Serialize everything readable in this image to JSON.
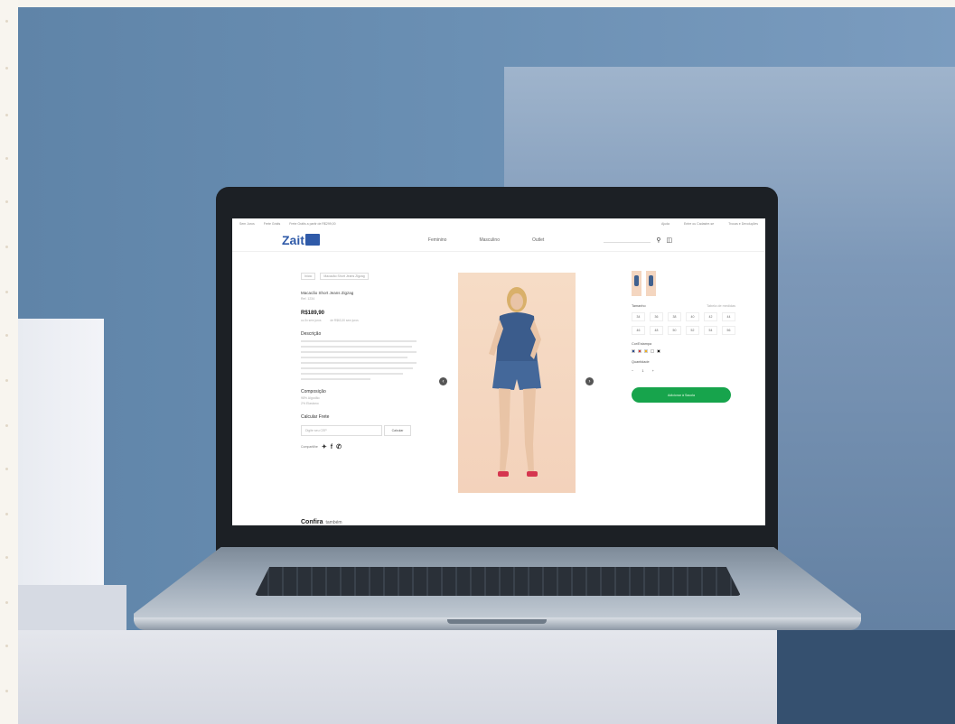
{
  "topbar": {
    "left": [
      "Sem Juros",
      "Frete Grátis",
      "Frete Grátis a partir de R$299,00"
    ],
    "right": [
      "Ajuda",
      "Entre ou Cadastre-se",
      "Trocas e Devoluções"
    ]
  },
  "header": {
    "logo_text": "Zait",
    "nav": [
      "Feminino",
      "Masculino",
      "Outlet"
    ],
    "search_placeholder": "Busque por produtos"
  },
  "product": {
    "breadcrumb": [
      "Início",
      "Macacão Short Jeans Zigzag"
    ],
    "title": "Macacão Short Jeans Zigzag",
    "ref": "Ref. 1234",
    "price": "R$189,90",
    "installments": [
      "ou 3x sem juros",
      "de R$63,30 sem juros"
    ],
    "description_title": "Descrição",
    "composition_title": "Composição",
    "composition": [
      "98% Algodão",
      "2% Elastano"
    ],
    "shipping_title": "Calcular Frete",
    "cep_placeholder": "Digite seu CEP",
    "cep_button": "Calcular",
    "share_label": "Compartilhe",
    "sizes_label": "Tamanho",
    "size_guide": "Tabela de medidas",
    "sizes": [
      "34",
      "36",
      "38",
      "40",
      "42",
      "44",
      "46",
      "48",
      "50",
      "52",
      "54",
      "56"
    ],
    "color_label": "Cor/Estampa",
    "colors": [
      "#2f4f8f",
      "#d23b3b",
      "#f0b020",
      "#ffffff",
      "#111111"
    ],
    "qty_label": "Quantidade",
    "qty_minus": "−",
    "qty_value": "1",
    "qty_plus": "+",
    "add_button": "Adicionar à Sacola",
    "below_title": "Confira",
    "below_sub": "também"
  }
}
